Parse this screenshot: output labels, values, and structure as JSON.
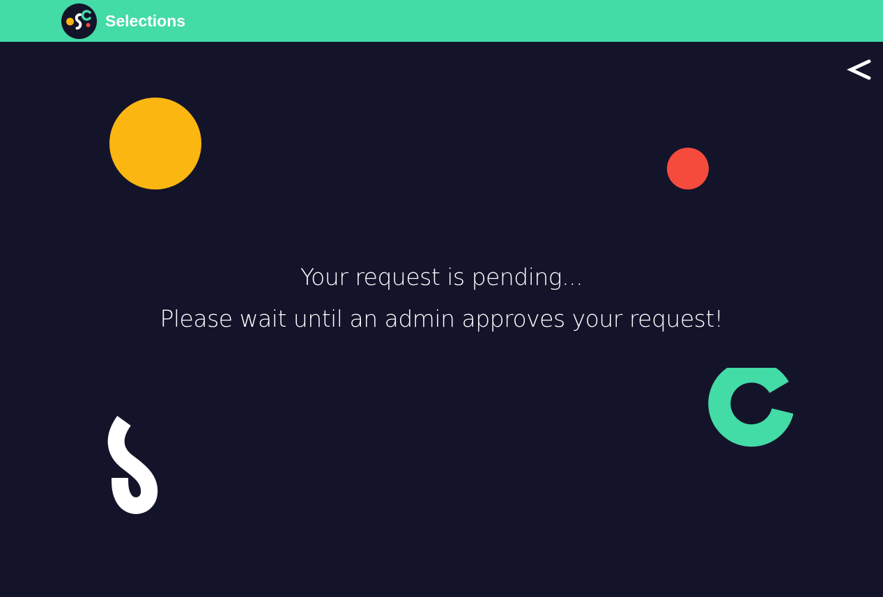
{
  "header": {
    "app_title": "Selections",
    "logo_icon": "osc-logo-icon",
    "background_color": "#43dba6"
  },
  "navigation": {
    "back_icon": "chevron-left-icon"
  },
  "status": {
    "title": "Your request is pending...",
    "message": "Please wait until an admin approves your request!"
  },
  "decorations": {
    "yellow_circle_color": "#fbb611",
    "red_circle_color": "#f44b3c",
    "s_shape_color": "#ffffff",
    "c_shape_color": "#43dba6"
  },
  "theme": {
    "page_background": "#13142a",
    "text_color": "#ffffff"
  }
}
